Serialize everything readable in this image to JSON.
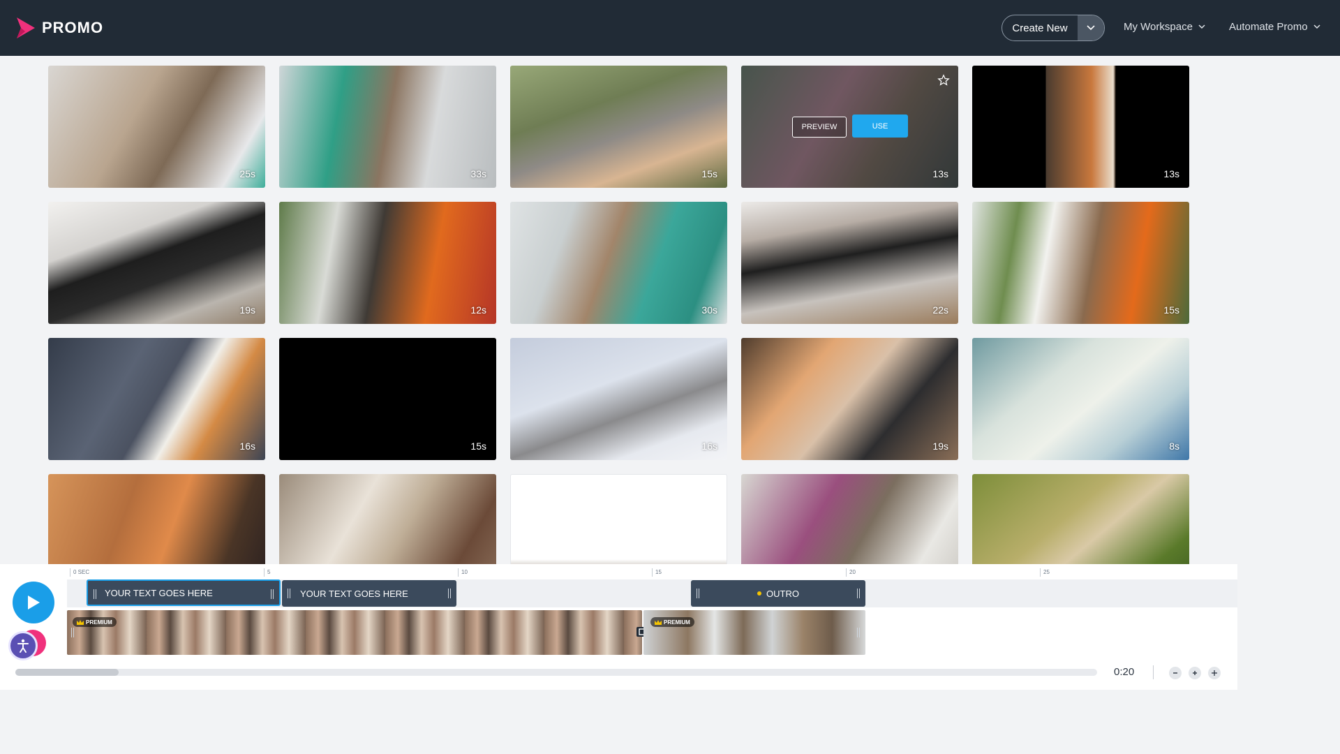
{
  "header": {
    "brand": "PROMO",
    "create_label": "Create New",
    "nav": [
      "My Workspace",
      "Automate Promo"
    ],
    "colors": {
      "bg": "#212b36",
      "logo_red": "#f0317c"
    }
  },
  "grid": {
    "tiles": [
      {
        "duration": "25s"
      },
      {
        "duration": "33s"
      },
      {
        "duration": "15s"
      },
      {
        "duration": "13s",
        "preview": "PREVIEW",
        "use": "USE"
      },
      {
        "duration": "13s"
      },
      {
        "duration": "19s"
      },
      {
        "duration": "12s"
      },
      {
        "duration": "30s"
      },
      {
        "duration": "22s"
      },
      {
        "duration": "15s"
      },
      {
        "duration": "16s"
      },
      {
        "duration": "15s"
      },
      {
        "duration": "16s"
      },
      {
        "duration": "19s"
      },
      {
        "duration": "8s"
      },
      {
        "duration": ""
      },
      {
        "duration": ""
      },
      {
        "duration": ""
      },
      {
        "duration": ""
      },
      {
        "duration": ""
      }
    ]
  },
  "timeline": {
    "ticks": [
      "0 SEC",
      "5",
      "10",
      "15",
      "20",
      "25"
    ],
    "text_blocks": [
      "YOUR TEXT GOES HERE",
      "YOUR TEXT GOES HERE"
    ],
    "outro_label": "OUTRO",
    "premium_label": "PREMIUM",
    "time": "0:20",
    "accent": "#1a9ee8"
  }
}
